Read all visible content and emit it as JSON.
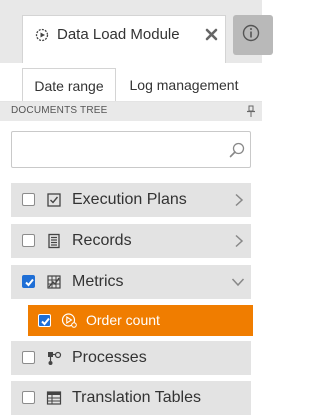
{
  "module_tab": {
    "title": "Data Load Module",
    "icon": "module-gear-icon",
    "close_icon": "close-icon"
  },
  "info_tab": {
    "icon": "info-icon"
  },
  "subtabs": [
    {
      "label": "Date range",
      "active": true
    },
    {
      "label": "Log management",
      "active": false
    }
  ],
  "documents_tree": {
    "title": "DOCUMENTS TREE",
    "pin_icon": "pin-icon",
    "search": {
      "value": "",
      "placeholder": "",
      "icon": "search-icon"
    },
    "items": [
      {
        "label": "Execution Plans",
        "icon": "checkbox-list-icon",
        "checked": false,
        "chevron": "chevron-right-icon"
      },
      {
        "label": "Records",
        "icon": "records-icon",
        "checked": false,
        "chevron": "chevron-right-icon"
      },
      {
        "label": "Metrics",
        "icon": "metrics-icon",
        "checked": true,
        "chevron": "chevron-down-icon",
        "children": [
          {
            "label": "Order count",
            "icon": "metric-item-icon",
            "checked": true,
            "selected": true
          }
        ]
      },
      {
        "label": "Processes",
        "icon": "processes-icon",
        "checked": false
      },
      {
        "label": "Translation Tables",
        "icon": "table-icon",
        "checked": false
      }
    ]
  },
  "colors": {
    "accent": "#f07d00",
    "checkbox_checked": "#1f6fd6",
    "row_background": "#e3e3e3",
    "header_background": "#e9e9e9"
  }
}
